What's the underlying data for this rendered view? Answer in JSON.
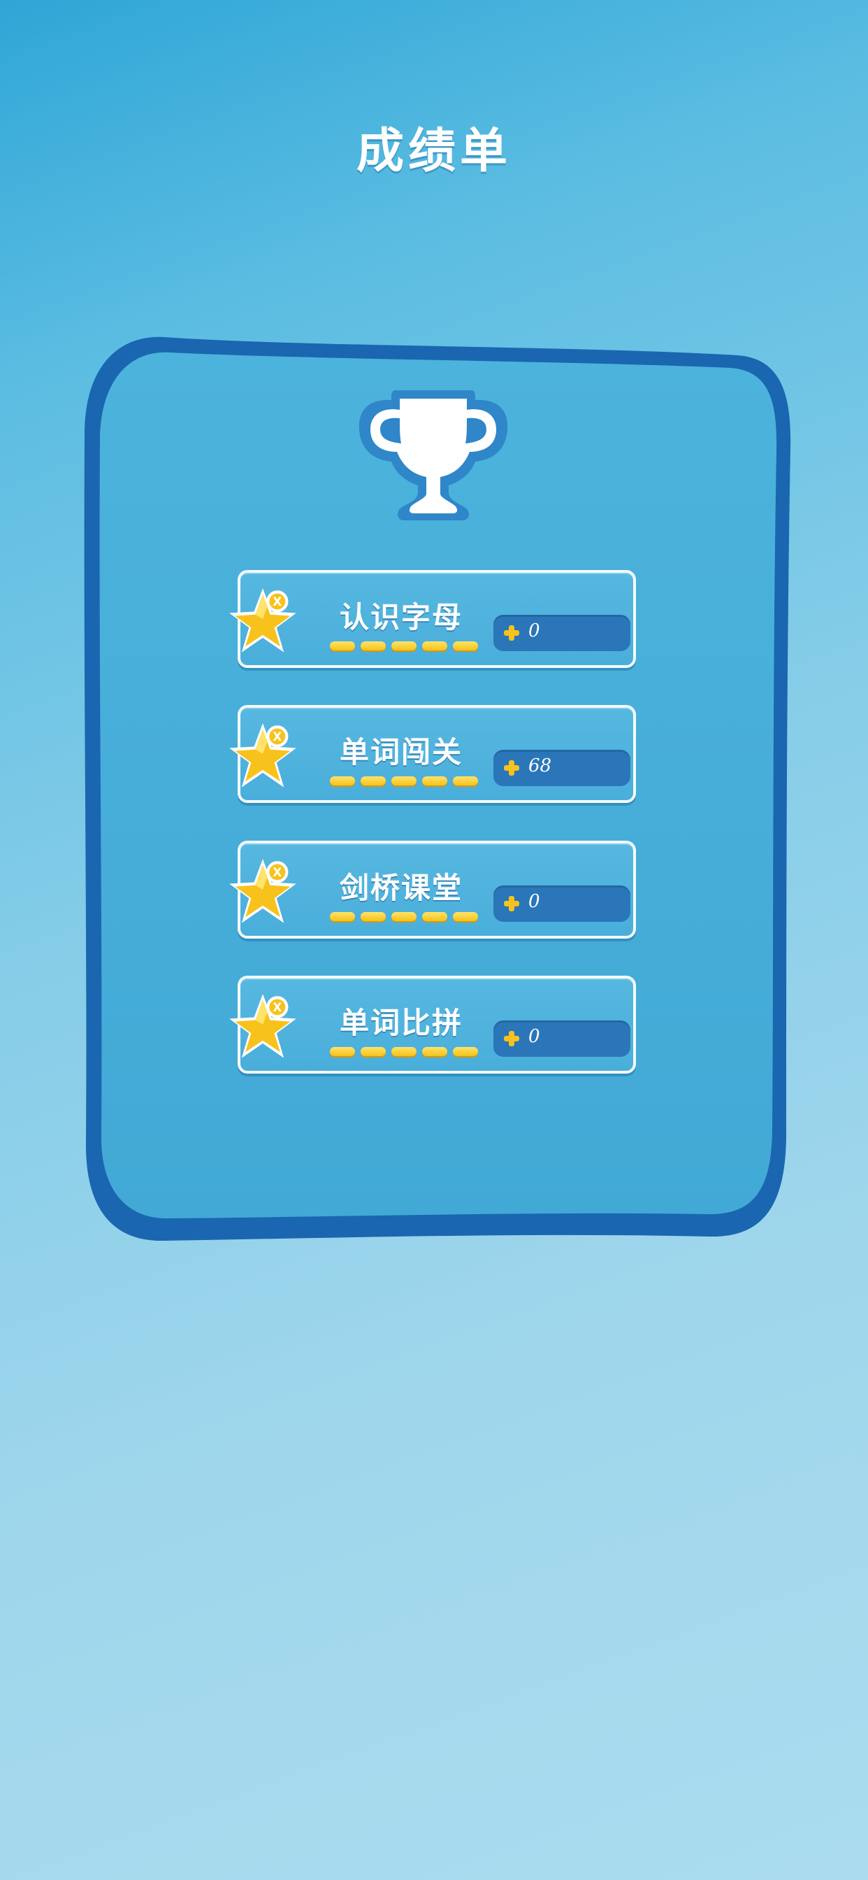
{
  "page": {
    "title": "成绩单"
  },
  "colors": {
    "background_top": "#2fa6d6",
    "background_bottom": "#aadcee",
    "panel_border": "#1a66b0",
    "panel_fill": "#46acd8",
    "card_fill": "#4aaedb",
    "score_box": "#2a76b8",
    "star": "#f7c21b",
    "pip": "#f7c21b"
  },
  "trophy": {
    "icon": "trophy-icon"
  },
  "cards": [
    {
      "label": "认识字母",
      "score": "0",
      "icon": "star-x-icon",
      "pips": 5
    },
    {
      "label": "单词闯关",
      "score": "68",
      "icon": "star-x-icon",
      "pips": 5
    },
    {
      "label": "剑桥课堂",
      "score": "0",
      "icon": "star-x-icon",
      "pips": 5
    },
    {
      "label": "单词比拼",
      "score": "0",
      "icon": "star-x-icon",
      "pips": 5
    }
  ]
}
